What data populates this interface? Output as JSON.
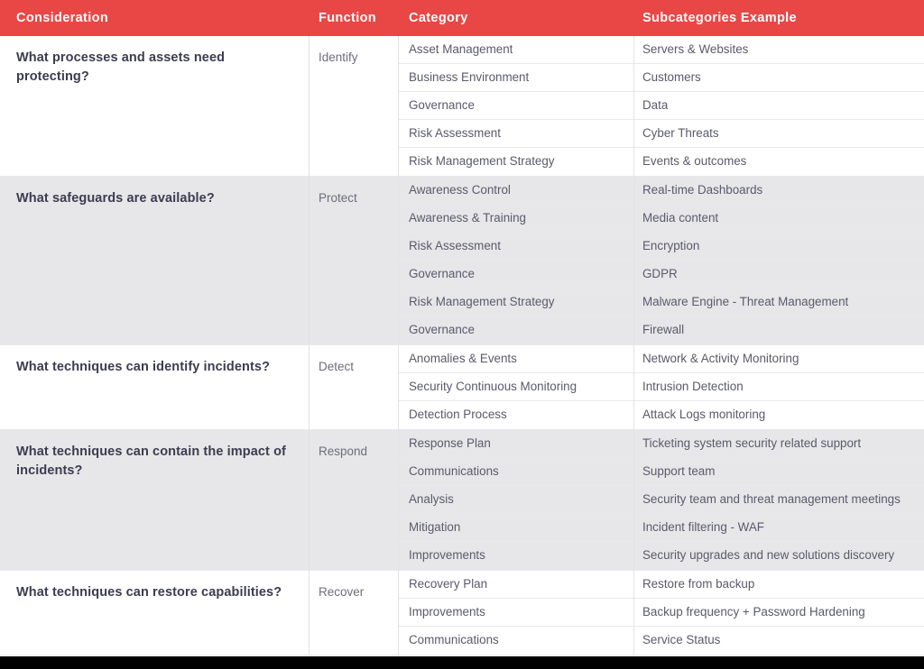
{
  "theme": {
    "header_bg": "#e84745",
    "header_text": "#ffffff",
    "shaded_row_bg": "#e7e7e9",
    "plain_row_bg": "#ffffff",
    "consideration_text": "#3c3c50",
    "function_text": "#6d6d7c",
    "cell_text": "#5a5a6b",
    "divider": "#e2e2e5",
    "bottom_bar": "#000000"
  },
  "header": {
    "consideration": "Consideration",
    "function": "Function",
    "category": "Category",
    "subcategories": "Subcategories Example"
  },
  "groups": [
    {
      "consideration": "What processes and assets need protecting?",
      "function": "Identify",
      "shaded": false,
      "rows": [
        {
          "category": "Asset Management",
          "subcategory": "Servers & Websites"
        },
        {
          "category": "Business Environment",
          "subcategory": "Customers"
        },
        {
          "category": "Governance",
          "subcategory": "Data"
        },
        {
          "category": "Risk Assessment",
          "subcategory": "Cyber Threats"
        },
        {
          "category": "Risk Management Strategy",
          "subcategory": "Events & outcomes"
        }
      ]
    },
    {
      "consideration": "What safeguards are available?",
      "function": "Protect",
      "shaded": true,
      "rows": [
        {
          "category": "Awareness Control",
          "subcategory": "Real-time Dashboards"
        },
        {
          "category": "Awareness & Training",
          "subcategory": "Media content"
        },
        {
          "category": "Risk Assessment",
          "subcategory": "Encryption"
        },
        {
          "category": "Governance",
          "subcategory": "GDPR"
        },
        {
          "category": "Risk Management Strategy",
          "subcategory": "Malware Engine - Threat Management"
        },
        {
          "category": "Governance",
          "subcategory": "Firewall"
        }
      ]
    },
    {
      "consideration": "What techniques can identify incidents?",
      "function": "Detect",
      "shaded": false,
      "rows": [
        {
          "category": "Anomalies & Events",
          "subcategory": "Network & Activity Monitoring"
        },
        {
          "category": "Security Continuous Monitoring",
          "subcategory": "Intrusion Detection"
        },
        {
          "category": "Detection Process",
          "subcategory": "Attack Logs monitoring"
        }
      ]
    },
    {
      "consideration": "What techniques can contain the impact of incidents?",
      "function": "Respond",
      "shaded": true,
      "rows": [
        {
          "category": "Response Plan",
          "subcategory": "Ticketing system security related support"
        },
        {
          "category": "Communications",
          "subcategory": "Support team"
        },
        {
          "category": "Analysis",
          "subcategory": "Security team and threat management meetings"
        },
        {
          "category": "Mitigation",
          "subcategory": "Incident filtering - WAF"
        },
        {
          "category": "Improvements",
          "subcategory": "Security upgrades and new solutions discovery"
        }
      ]
    },
    {
      "consideration": "What techniques can restore capabilities?",
      "function": "Recover",
      "shaded": false,
      "rows": [
        {
          "category": "Recovery Plan",
          "subcategory": "Restore from backup"
        },
        {
          "category": "Improvements",
          "subcategory": "Backup frequency +  Password Hardening"
        },
        {
          "category": "Communications",
          "subcategory": "Service Status"
        }
      ]
    }
  ]
}
